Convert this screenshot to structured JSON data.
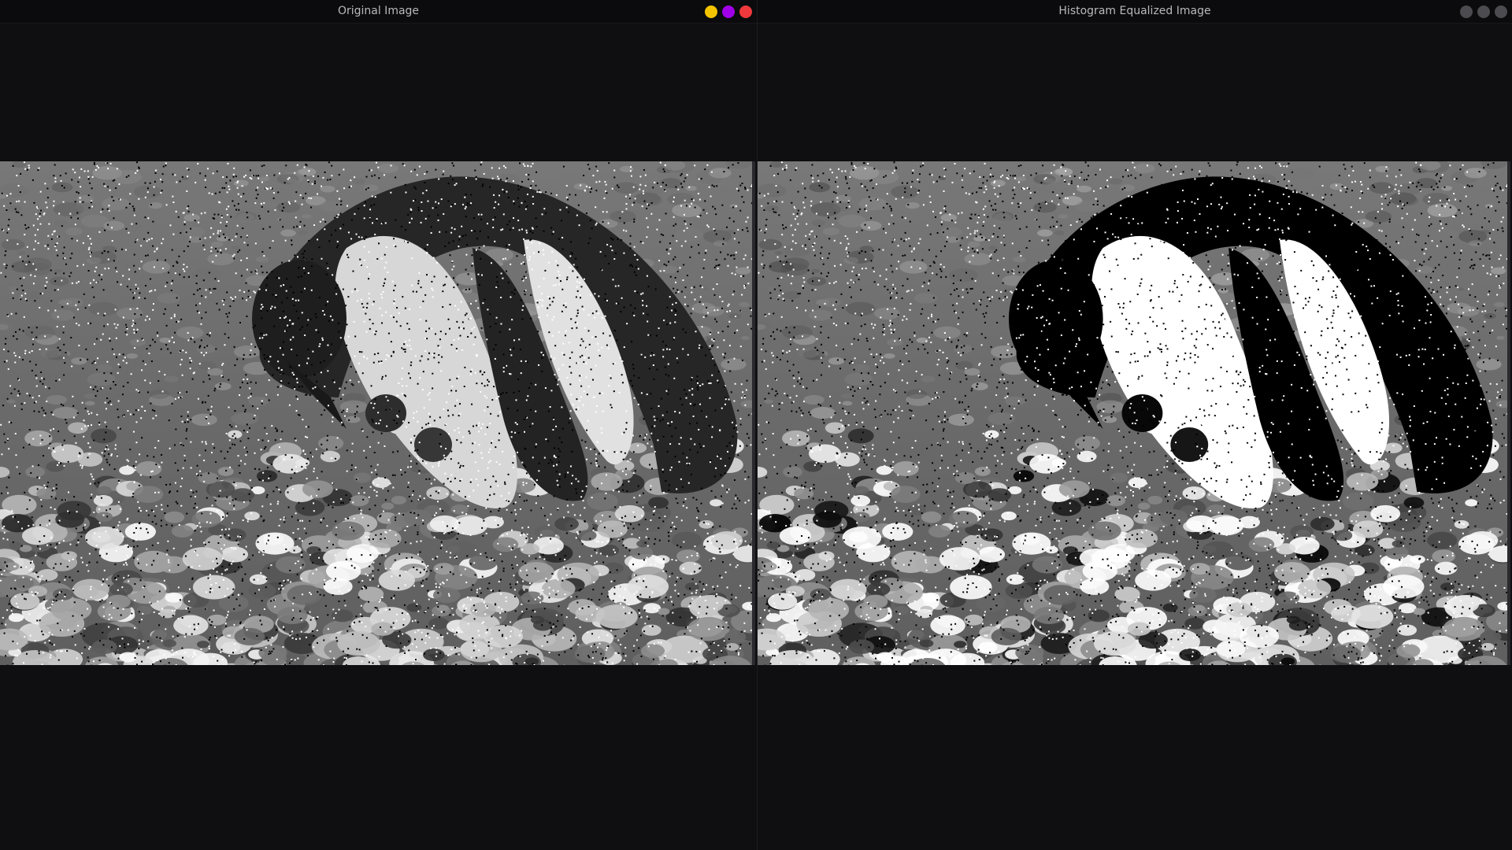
{
  "windows": {
    "original": {
      "title": "Original Image",
      "controls": [
        {
          "name": "minimize",
          "color": "#f5c400"
        },
        {
          "name": "maximize",
          "color": "#a000e8"
        },
        {
          "name": "close",
          "color": "#f0393c"
        }
      ]
    },
    "equalized": {
      "title": "Histogram Equalized Image",
      "controls": [
        {
          "name": "minimize",
          "color": "#4b4b50"
        },
        {
          "name": "maximize",
          "color": "#4b4b50"
        },
        {
          "name": "close",
          "color": "#4b4b50"
        }
      ]
    }
  },
  "images": {
    "original": {
      "subject": "penguin on rocky nest, grayscale with salt-and-pepper noise"
    },
    "equalized": {
      "subject": "penguin on rocky nest, histogram equalized, salt-and-pepper noise"
    }
  }
}
